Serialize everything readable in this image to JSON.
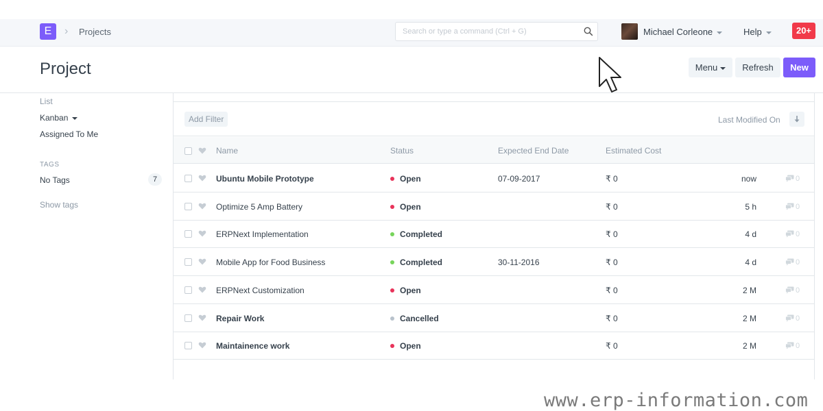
{
  "app": {
    "logo_letter": "E",
    "breadcrumb": "Projects"
  },
  "search": {
    "placeholder": "Search or type a command (Ctrl + G)"
  },
  "user": {
    "name": "Michael Corleone"
  },
  "help_label": "Help",
  "notifications": "20+",
  "page": {
    "title": "Project",
    "menu_label": "Menu",
    "refresh_label": "Refresh",
    "new_label": "New"
  },
  "sidebar": {
    "list": "List",
    "kanban": "Kanban",
    "assigned": "Assigned To Me",
    "tags_heading": "TAGS",
    "no_tags": "No Tags",
    "no_tags_count": "7",
    "show_tags": "Show tags"
  },
  "filters": {
    "add_filter": "Add Filter",
    "sort_label": "Last Modified On"
  },
  "columns": {
    "name": "Name",
    "status": "Status",
    "end_date": "Expected End Date",
    "cost": "Estimated Cost"
  },
  "status_colors": {
    "Open": "#e8335a",
    "Completed": "#77d45b",
    "Cancelled": "#b8c2cc"
  },
  "rows": [
    {
      "name": "Ubuntu Mobile Prototype",
      "bold": true,
      "status": "Open",
      "end_date": "07-09-2017",
      "cost": "₹ 0",
      "modified": "now",
      "comments": "0"
    },
    {
      "name": "Optimize 5 Amp Battery",
      "bold": false,
      "status": "Open",
      "end_date": "",
      "cost": "₹ 0",
      "modified": "5 h",
      "comments": "0"
    },
    {
      "name": "ERPNext Implementation",
      "bold": false,
      "status": "Completed",
      "end_date": "",
      "cost": "₹ 0",
      "modified": "4 d",
      "comments": "0"
    },
    {
      "name": "Mobile App for Food Business",
      "bold": false,
      "status": "Completed",
      "end_date": "30-11-2016",
      "cost": "₹ 0",
      "modified": "4 d",
      "comments": "0"
    },
    {
      "name": "ERPNext Customization",
      "bold": false,
      "status": "Open",
      "end_date": "",
      "cost": "₹ 0",
      "modified": "2 M",
      "comments": "0"
    },
    {
      "name": "Repair Work",
      "bold": true,
      "status": "Cancelled",
      "end_date": "",
      "cost": "₹ 0",
      "modified": "2 M",
      "comments": "0"
    },
    {
      "name": "Maintainence work",
      "bold": true,
      "status": "Open",
      "end_date": "",
      "cost": "₹ 0",
      "modified": "2 M",
      "comments": "0"
    }
  ],
  "watermark": "www.erp-information.com"
}
